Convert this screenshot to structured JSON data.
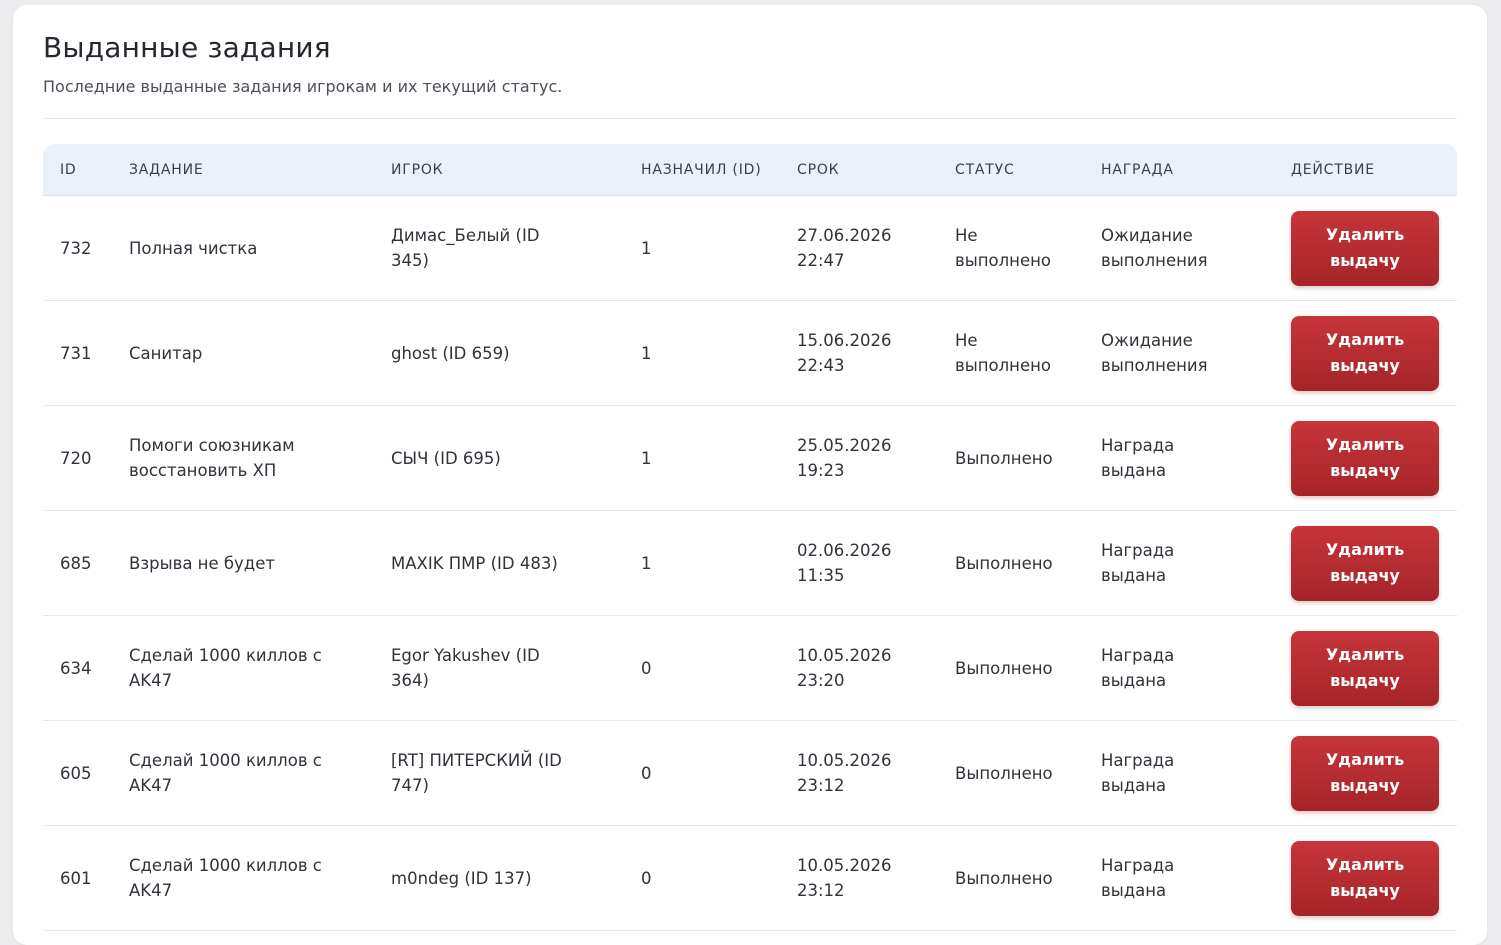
{
  "header": {
    "title": "Выданные задания",
    "subtitle": "Последние выданные задания игрокам и их текущий статус."
  },
  "table": {
    "columns": [
      "ID",
      "ЗАДАНИЕ",
      "ИГРОК",
      "НАЗНАЧИЛ (ID)",
      "СРОК",
      "СТАТУС",
      "НАГРАДА",
      "ДЕЙСТВИЕ"
    ],
    "rows": [
      {
        "id": "732",
        "task": "Полная чистка",
        "player": "Димас_Белый (ID 345)",
        "assigned_by": "1",
        "due": "27.06.2026 22:47",
        "status": "Не выполнено",
        "reward": "Ожидание выполнения",
        "action": "Удалить выдачу"
      },
      {
        "id": "731",
        "task": "Санитар",
        "player": "ghost (ID 659)",
        "assigned_by": "1",
        "due": "15.06.2026 22:43",
        "status": "Не выполнено",
        "reward": "Ожидание выполнения",
        "action": "Удалить выдачу"
      },
      {
        "id": "720",
        "task": "Помоги союзникам восстановить ХП",
        "player": "СЫЧ (ID 695)",
        "assigned_by": "1",
        "due": "25.05.2026 19:23",
        "status": "Выполнено",
        "reward": "Награда выдана",
        "action": "Удалить выдачу"
      },
      {
        "id": "685",
        "task": "Взрыва не будет",
        "player": "MAXIK ПМР (ID 483)",
        "assigned_by": "1",
        "due": "02.06.2026 11:35",
        "status": "Выполнено",
        "reward": "Награда выдана",
        "action": "Удалить выдачу"
      },
      {
        "id": "634",
        "task": "Сделай 1000 киллов с AK47",
        "player": "Egor Yakushev (ID 364)",
        "assigned_by": "0",
        "due": "10.05.2026 23:20",
        "status": "Выполнено",
        "reward": "Награда выдана",
        "action": "Удалить выдачу"
      },
      {
        "id": "605",
        "task": "Сделай 1000 киллов с AK47",
        "player": "[RT] ПИТЕРСКИЙ (ID 747)",
        "assigned_by": "0",
        "due": "10.05.2026 23:12",
        "status": "Выполнено",
        "reward": "Награда выдана",
        "action": "Удалить выдачу"
      },
      {
        "id": "601",
        "task": "Сделай 1000 киллов с AK47",
        "player": "m0ndeg (ID 137)",
        "assigned_by": "0",
        "due": "10.05.2026 23:12",
        "status": "Выполнено",
        "reward": "Награда выдана",
        "action": "Удалить выдачу"
      }
    ]
  },
  "colors": {
    "header_bg": "#eaf1fb",
    "danger": "#b82c31"
  }
}
